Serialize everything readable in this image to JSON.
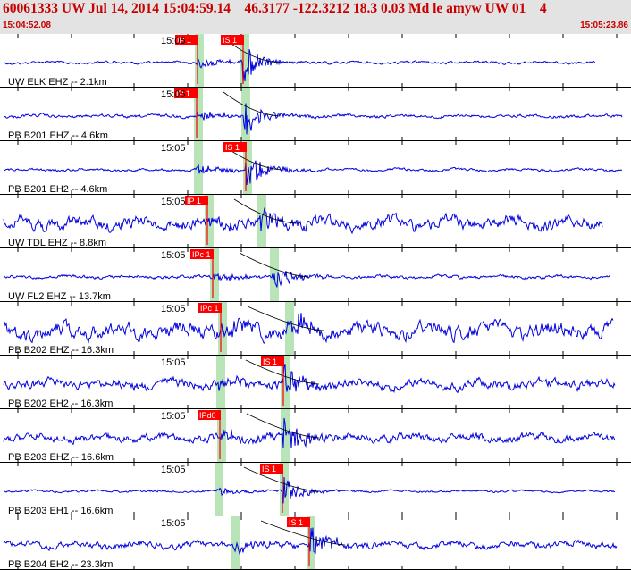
{
  "header": {
    "title": "60061333 UW Jul 14, 2014 15:04:59.14    46.3177 -122.3212 18.3 0.03 Md le amyw UW 01    4",
    "time_start": "15:04:52.08",
    "time_end": "15:05:23.86"
  },
  "colors": {
    "header_bg": "#e3e3e3",
    "header_text": "#c80000",
    "trace": "#0000dd",
    "pick": "#ff0000",
    "window": "#b8e4b8",
    "grid": "#000000"
  },
  "traces": [
    {
      "label": "UW ELK EHZ -- 2.1km",
      "time_label": "15:05",
      "noise": 0.1,
      "p_label": "IP 1",
      "s_label": "IS 1",
      "p_time": 221,
      "s_time": 272,
      "amp": 1.0,
      "end": 666
    },
    {
      "label": "PB B201 EHZ -- 4.6km",
      "time_label": "15:05",
      "noise": 0.12,
      "p_label": "IP 1",
      "s_label": "",
      "p_time": 220,
      "s_time": 273,
      "amp": 1.0,
      "end": 696
    },
    {
      "label": "PB B201 EH2 -- 4.6km",
      "time_label": "15:05",
      "noise": 0.1,
      "p_label": "",
      "s_label": "IS 1",
      "p_time": 220,
      "s_time": 275,
      "amp": 1.0,
      "end": 696
    },
    {
      "label": "UW TDL EHZ -- 8.8km",
      "time_label": "15:05",
      "noise": 0.45,
      "p_label": "IP 1",
      "s_label": "",
      "p_time": 232,
      "s_time": 291,
      "amp": 0.8,
      "end": 674
    },
    {
      "label": "UW FL2 EHZ -- 13.7km",
      "time_label": "15:05",
      "noise": 0.12,
      "p_label": "IPc 1",
      "s_label": "",
      "p_time": 238,
      "s_time": 305,
      "amp": 0.9,
      "end": 683
    },
    {
      "label": "PB B202 EHZ -- 16.3km",
      "time_label": "15:05",
      "noise": 0.55,
      "p_label": "IPc 1",
      "s_label": "",
      "p_time": 247,
      "s_time": 322,
      "amp": 0.9,
      "end": 686
    },
    {
      "label": "PB B202 EH2 -- 16.3km",
      "time_label": "15:05",
      "noise": 0.35,
      "p_label": "",
      "s_label": "IS 1",
      "p_time": 245,
      "s_time": 317,
      "amp": 0.9,
      "end": 688
    },
    {
      "label": "PB B203 EHZ -- 16.6km",
      "time_label": "15:05",
      "noise": 0.3,
      "p_label": "IPd0",
      "s_label": "",
      "p_time": 246,
      "s_time": 317,
      "amp": 1.0,
      "end": 688
    },
    {
      "label": "PB B203 EH1 -- 16.6km",
      "time_label": "15:05",
      "noise": 0.08,
      "p_label": "",
      "s_label": "IS 1",
      "p_time": 243,
      "s_time": 316,
      "amp": 0.8,
      "end": 688
    },
    {
      "label": "PB B204 EH2 -- 23.3km",
      "time_label": "15:05",
      "noise": 0.25,
      "p_label": "",
      "s_label": "IS 1",
      "p_time": 262,
      "s_time": 346,
      "amp": 1.0,
      "end": 690
    }
  ]
}
